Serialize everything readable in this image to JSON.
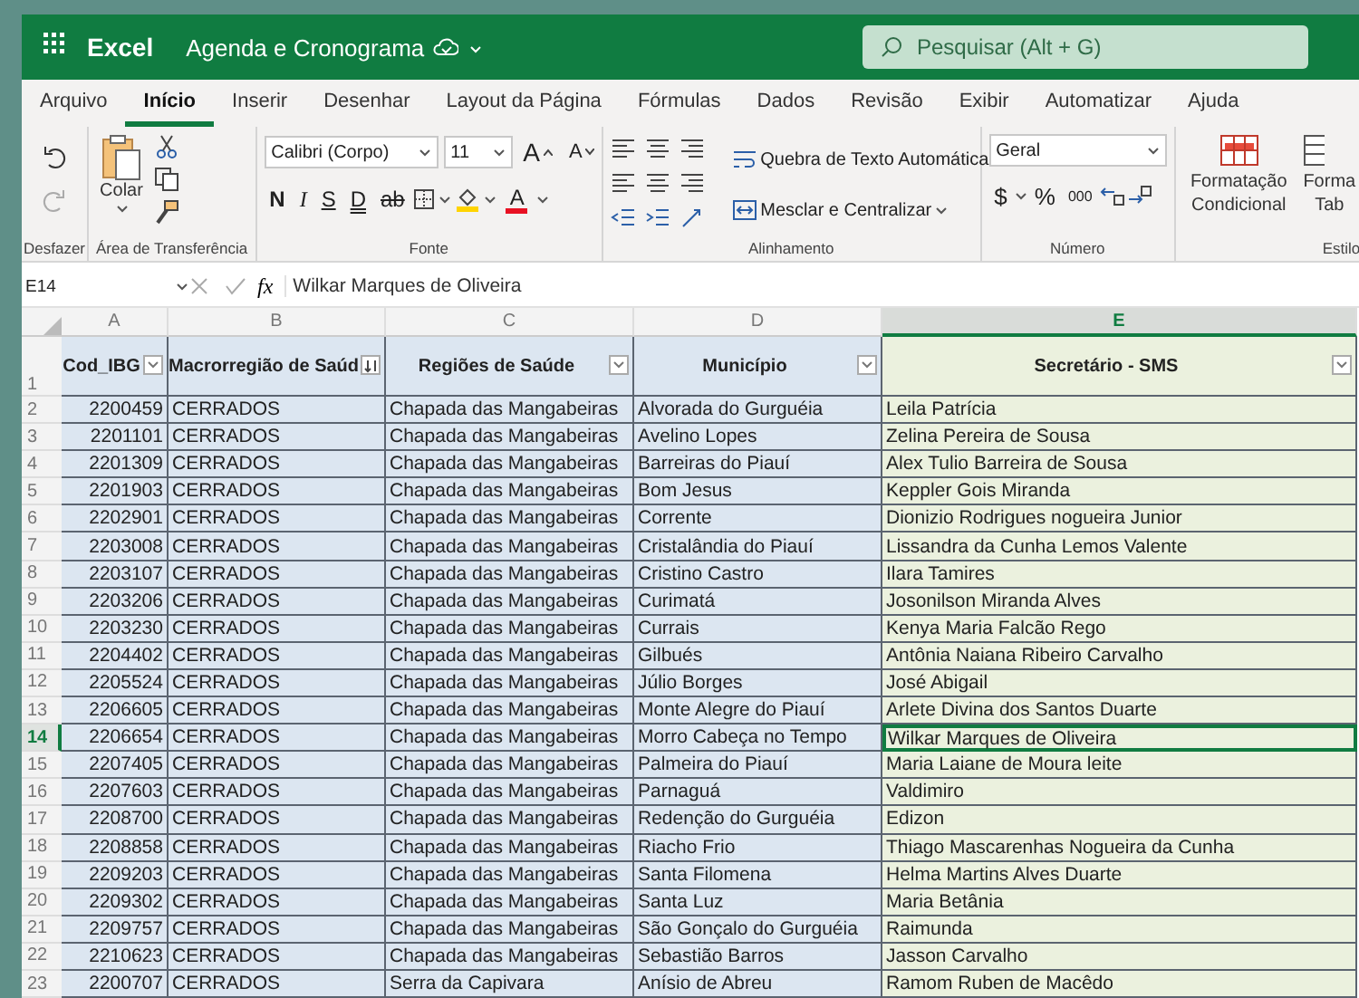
{
  "title_bar": {
    "app": "Excel",
    "document": "Agenda e Cronograma",
    "search_placeholder": "Pesquisar (Alt + G)"
  },
  "menu_tabs": [
    {
      "label": "Arquivo",
      "selected": false
    },
    {
      "label": "Início",
      "selected": true
    },
    {
      "label": "Inserir",
      "selected": false
    },
    {
      "label": "Desenhar",
      "selected": false
    },
    {
      "label": "Layout da Página",
      "selected": false
    },
    {
      "label": "Fórmulas",
      "selected": false
    },
    {
      "label": "Dados",
      "selected": false
    },
    {
      "label": "Revisão",
      "selected": false
    },
    {
      "label": "Exibir",
      "selected": false
    },
    {
      "label": "Automatizar",
      "selected": false
    },
    {
      "label": "Ajuda",
      "selected": false
    }
  ],
  "ribbon": {
    "undo_group": "Desfazer",
    "clipboard_group": "Área de Transferência",
    "paste": "Colar",
    "font_group": "Fonte",
    "font_name": "Calibri (Corpo)",
    "font_size": "11",
    "font_size_buttons": [
      {
        "label": "A",
        "kind": "grow"
      },
      {
        "label": "A",
        "kind": "shrink"
      }
    ],
    "style_buttons": [
      {
        "label": "N",
        "kind": "bold"
      },
      {
        "label": "I",
        "kind": "italic"
      },
      {
        "label": "S",
        "kind": "underline"
      },
      {
        "label": "D",
        "kind": "double"
      },
      {
        "label": "ab",
        "kind": "strike"
      }
    ],
    "font_color_label": "A",
    "alignment_group": "Alinhamento",
    "wrap_text": "Quebra de Texto Automática",
    "merge_center": "Mesclar e Centralizar",
    "number_group": "Número",
    "number_format": "Geral",
    "number_buttons": [
      "$",
      "%",
      "000"
    ],
    "styles_group": "Estilo",
    "conditional_format": "Formatação Condicional",
    "format_table": "Forma Tab"
  },
  "formula_bar": {
    "name_box": "E14",
    "function_label": "fx",
    "content": "Wilkar Marques de Oliveira"
  },
  "sheet": {
    "column_letters": [
      {
        "label": "A",
        "selected": false
      },
      {
        "label": "B",
        "selected": false
      },
      {
        "label": "C",
        "selected": false
      },
      {
        "label": "D",
        "selected": false
      },
      {
        "label": "E",
        "selected": true
      }
    ],
    "header_row_number": "1",
    "headers": [
      {
        "label": "Cod_IBG",
        "kind": "filter"
      },
      {
        "label": "Macrorregião de Saúd",
        "kind": "sort"
      },
      {
        "label": "Regiões de Saúde",
        "kind": "filter"
      },
      {
        "label": "Município",
        "kind": "filter"
      },
      {
        "label": "Secretário - SMS",
        "kind": "filter"
      }
    ],
    "rows": [
      {
        "number": "2",
        "selected": false,
        "cells": [
          "2200459",
          "CERRADOS",
          "Chapada das Mangabeiras",
          "Alvorada do Gurguéia",
          "Leila Patrícia"
        ]
      },
      {
        "number": "3",
        "selected": false,
        "cells": [
          "2201101",
          "CERRADOS",
          "Chapada das Mangabeiras",
          "Avelino Lopes",
          "Zelina Pereira de Sousa"
        ]
      },
      {
        "number": "4",
        "selected": false,
        "cells": [
          "2201309",
          "CERRADOS",
          "Chapada das Mangabeiras",
          "Barreiras do Piauí",
          "Alex Tulio Barreira de Sousa"
        ]
      },
      {
        "number": "5",
        "selected": false,
        "cells": [
          "2201903",
          "CERRADOS",
          "Chapada das Mangabeiras",
          "Bom Jesus",
          "Keppler Gois Miranda"
        ]
      },
      {
        "number": "6",
        "selected": false,
        "cells": [
          "2202901",
          "CERRADOS",
          "Chapada das Mangabeiras",
          "Corrente",
          "Dionizio Rodrigues nogueira Junior"
        ]
      },
      {
        "number": "7",
        "selected": false,
        "cells": [
          "2203008",
          "CERRADOS",
          "Chapada das Mangabeiras",
          "Cristalândia do Piauí",
          "Lissandra da Cunha Lemos Valente"
        ]
      },
      {
        "number": "8",
        "selected": false,
        "cells": [
          "2203107",
          "CERRADOS",
          "Chapada das Mangabeiras",
          "Cristino Castro",
          "Ilara Tamires"
        ]
      },
      {
        "number": "9",
        "selected": false,
        "cells": [
          "2203206",
          "CERRADOS",
          "Chapada das Mangabeiras",
          "Curimatá",
          "Josonilson Miranda Alves"
        ]
      },
      {
        "number": "10",
        "selected": false,
        "cells": [
          "2203230",
          "CERRADOS",
          "Chapada das Mangabeiras",
          "Currais",
          "Kenya Maria Falcão Rego"
        ]
      },
      {
        "number": "11",
        "selected": false,
        "cells": [
          "2204402",
          "CERRADOS",
          "Chapada das Mangabeiras",
          "Gilbués",
          "Antônia Naiana Ribeiro Carvalho"
        ]
      },
      {
        "number": "12",
        "selected": false,
        "cells": [
          "2205524",
          "CERRADOS",
          "Chapada das Mangabeiras",
          "Júlio Borges",
          "José Abigail"
        ]
      },
      {
        "number": "13",
        "selected": false,
        "cells": [
          "2206605",
          "CERRADOS",
          "Chapada das Mangabeiras",
          "Monte Alegre do Piauí",
          "Arlete Divina dos Santos Duarte"
        ]
      },
      {
        "number": "14",
        "selected": true,
        "cells": [
          "2206654",
          "CERRADOS",
          "Chapada das Mangabeiras",
          "Morro Cabeça no Tempo",
          "Wilkar Marques de Oliveira"
        ]
      },
      {
        "number": "15",
        "selected": false,
        "cells": [
          "2207405",
          "CERRADOS",
          "Chapada das Mangabeiras",
          "Palmeira do Piauí",
          "Maria Laiane de Moura leite"
        ]
      },
      {
        "number": "16",
        "selected": false,
        "cells": [
          "2207603",
          "CERRADOS",
          "Chapada das Mangabeiras",
          "Parnaguá",
          "Valdimiro"
        ]
      },
      {
        "number": "17",
        "selected": false,
        "cells": [
          "2208700",
          "CERRADOS",
          "Chapada das Mangabeiras",
          "Redenção do Gurguéia",
          "Edizon"
        ]
      },
      {
        "number": "18",
        "selected": false,
        "cells": [
          "2208858",
          "CERRADOS",
          "Chapada das Mangabeiras",
          "Riacho Frio",
          "Thiago Mascarenhas Nogueira da Cunha"
        ]
      },
      {
        "number": "19",
        "selected": false,
        "cells": [
          "2209203",
          "CERRADOS",
          "Chapada das Mangabeiras",
          "Santa Filomena",
          "Helma Martins Alves Duarte"
        ]
      },
      {
        "number": "20",
        "selected": false,
        "cells": [
          "2209302",
          "CERRADOS",
          "Chapada das Mangabeiras",
          "Santa Luz",
          "Maria Betânia"
        ]
      },
      {
        "number": "21",
        "selected": false,
        "cells": [
          "2209757",
          "CERRADOS",
          "Chapada das Mangabeiras",
          "São Gonçalo do Gurguéia",
          "Raimunda"
        ]
      },
      {
        "number": "22",
        "selected": false,
        "cells": [
          "2210623",
          "CERRADOS",
          "Chapada das Mangabeiras",
          "Sebastião Barros",
          "Jasson Carvalho"
        ]
      },
      {
        "number": "23",
        "selected": false,
        "cells": [
          "2200707",
          "CERRADOS",
          "Serra da Capivara",
          "Anísio de Abreu",
          "Ramom Ruben de Macêdo"
        ]
      }
    ]
  }
}
